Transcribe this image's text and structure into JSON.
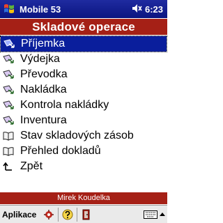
{
  "statusbar": {
    "app_title": "Mobile 53",
    "time": "6:23",
    "start_icon": "windows-flag-icon",
    "volume_icon": "speaker-icon"
  },
  "header": {
    "title": "Skladové operace"
  },
  "menu": {
    "items": [
      {
        "label": "Příjemka",
        "icon": "document-arrow-icon",
        "selected": true
      },
      {
        "label": "Výdejka",
        "icon": "document-arrow-icon"
      },
      {
        "label": "Převodka",
        "icon": "document-arrow-icon"
      },
      {
        "label": "Nakládka",
        "icon": "document-arrow-icon"
      },
      {
        "label": "Kontrola nakládky",
        "icon": "document-arrow-icon"
      },
      {
        "label": "Inventura",
        "icon": "document-arrow-icon"
      },
      {
        "label": "Stav skladových zásob",
        "icon": "book-icon"
      },
      {
        "label": "Přehled dokladů",
        "icon": "book-icon"
      },
      {
        "label": "Zpět",
        "icon": "back-arrow-icon"
      }
    ]
  },
  "userbar": {
    "user": "Mirek Koudelka"
  },
  "menubar": {
    "label": "Aplikace",
    "buttons": [
      "settings-icon",
      "help-icon",
      "exit-door-icon"
    ],
    "keyboard_icon": "keyboard-icon"
  },
  "colors": {
    "titlebar": "#0a1480",
    "header": "#a52016",
    "selection": "#0a1e9c"
  }
}
